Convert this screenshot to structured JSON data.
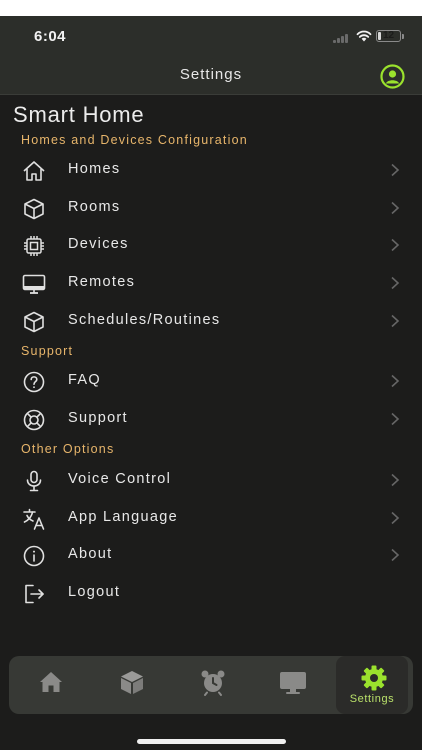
{
  "status_bar": {
    "time": "6:04",
    "battery_level": "12",
    "battery_fraction": 0.12
  },
  "nav": {
    "title": "Settings",
    "profile_icon": "profile-icon"
  },
  "page_title": "Smart Home",
  "sections": [
    {
      "header": "Homes and Devices Configuration",
      "items": [
        {
          "label": "Homes",
          "icon": "house-icon"
        },
        {
          "label": "Rooms",
          "icon": "cube-icon"
        },
        {
          "label": "Devices",
          "icon": "chip-icon"
        },
        {
          "label": "Remotes",
          "icon": "monitor-icon"
        },
        {
          "label": "Schedules/Routines",
          "icon": "cube-icon"
        }
      ]
    },
    {
      "header": "Support",
      "items": [
        {
          "label": "FAQ",
          "icon": "question-circle-icon"
        },
        {
          "label": "Support",
          "icon": "lifebuoy-icon"
        }
      ]
    },
    {
      "header": "Other Options",
      "items": [
        {
          "label": "Voice Control",
          "icon": "microphone-icon"
        },
        {
          "label": "App Language",
          "icon": "translate-icon"
        },
        {
          "label": "About",
          "icon": "info-circle-icon"
        },
        {
          "label": "Logout",
          "icon": "logout-icon"
        }
      ]
    }
  ],
  "tab_bar": {
    "tabs": [
      {
        "icon": "home-icon",
        "label": ""
      },
      {
        "icon": "box-icon",
        "label": ""
      },
      {
        "icon": "alarm-clock-icon",
        "label": ""
      },
      {
        "icon": "monitor-icon",
        "label": ""
      },
      {
        "icon": "gear-icon",
        "label": "Settings"
      }
    ],
    "active_index": 4
  },
  "colors": {
    "background": "#1c1c1b",
    "bar": "#2c2e2a",
    "section_header": "#e7b56b",
    "accent_green": "#9be22d",
    "text": "#e8e8e8"
  }
}
